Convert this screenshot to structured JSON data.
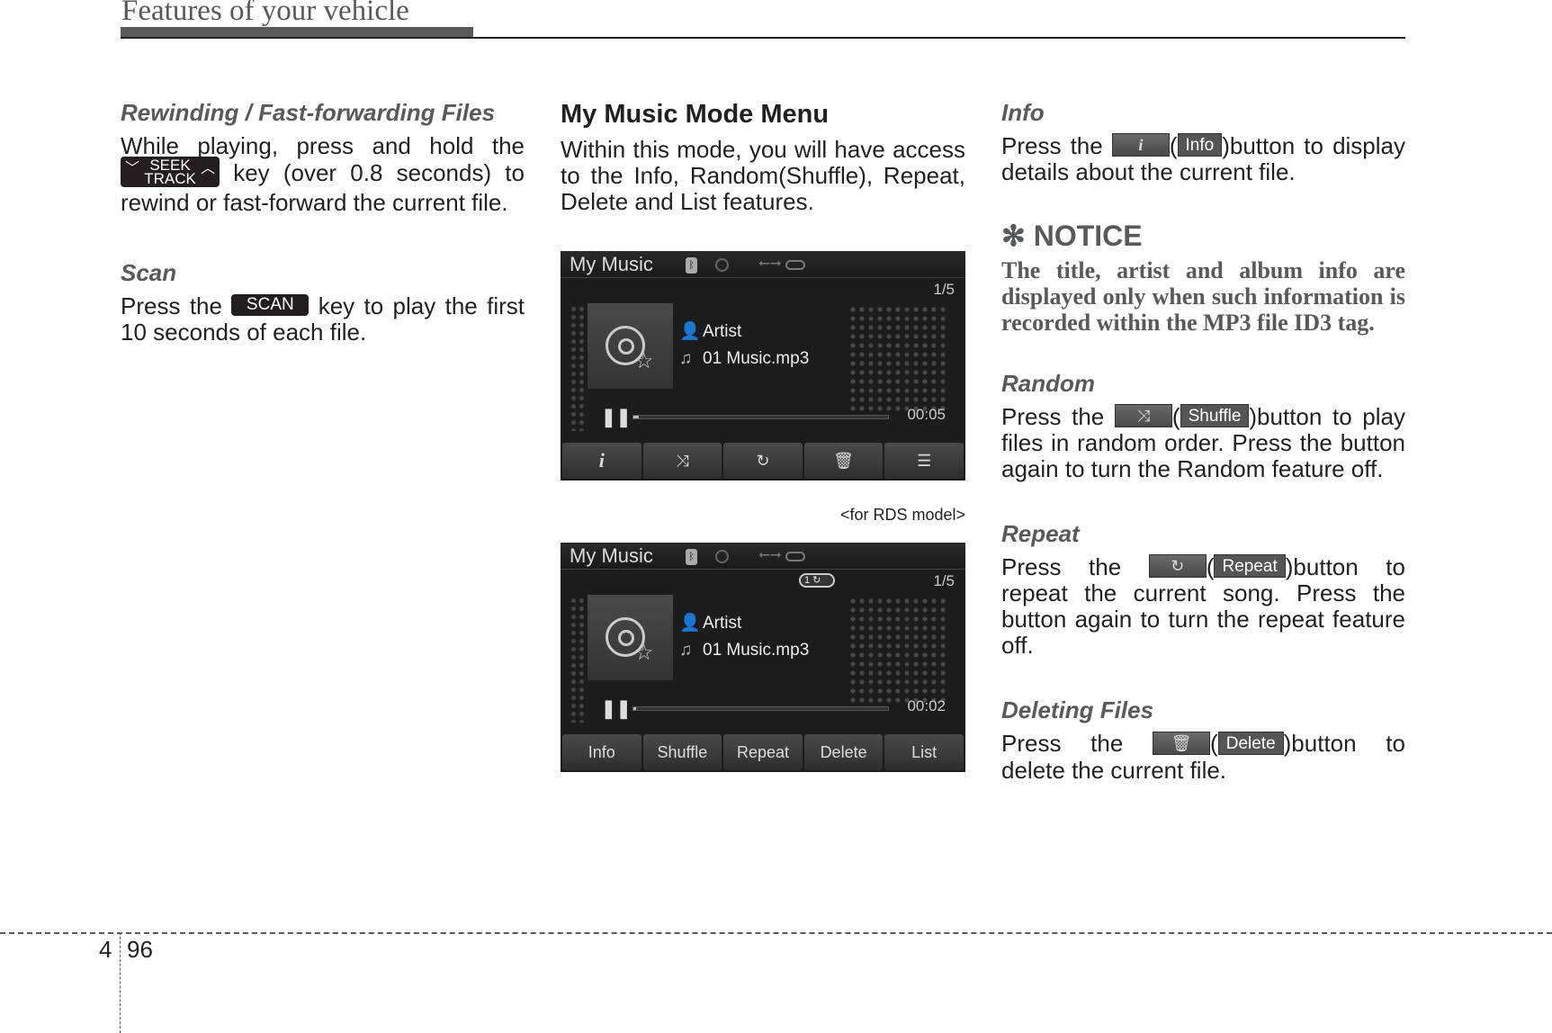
{
  "header": {
    "title": "Features of your vehicle"
  },
  "left": {
    "rewind": {
      "title": "Rewinding / Fast-forwarding Files",
      "text_before": "While playing, press and hold the",
      "key_top": "SEEK",
      "key_bottom": "TRACK",
      "text_after": "key (over 0.8 seconds) to rewind or fast-forward the current file."
    },
    "scan": {
      "title": "Scan",
      "text_before": "Press the",
      "key": "SCAN",
      "text_after": "key to play the first 10 seconds of each file."
    }
  },
  "middle": {
    "title": "My Music Mode Menu",
    "text": "Within this mode, you will have access to the Info, Random(Shuffle), Repeat, Delete and List features.",
    "caption": "<for RDS model>",
    "screens": [
      {
        "title": "My Music",
        "count": "1/5",
        "artist": "Artist",
        "file": "01 Music.mp3",
        "time": "00:05",
        "progress": 0.02,
        "buttons": [
          "i",
          "⤨",
          "↻",
          "🗑",
          "☰"
        ]
      },
      {
        "title": "My Music",
        "count": "1/5",
        "repeat_badge": "1",
        "artist": "Artist",
        "file": "01 Music.mp3",
        "time": "00:02",
        "progress": 0.01,
        "buttons": [
          "Info",
          "Shuffle",
          "Repeat",
          "Delete",
          "List"
        ]
      }
    ]
  },
  "right": {
    "info": {
      "title": "Info",
      "before": "Press the",
      "icon": "i",
      "label": "Info",
      "after": ")button to display details about the current file."
    },
    "notice": {
      "title": "✻ NOTICE",
      "text": "The title, artist and album info are displayed only when such information is recorded within the MP3 file ID3 tag."
    },
    "random": {
      "title": "Random",
      "before": "Press the",
      "icon": "⤨",
      "label": "Shuffle",
      "after": ")button to play files in random order. Press the button again to turn the Random feature off."
    },
    "repeat": {
      "title": "Repeat",
      "before": "Press the",
      "icon": "↻",
      "label": "Repeat",
      "after": ")button to repeat the current song. Press the button again to turn the repeat feature off."
    },
    "delete": {
      "title": "Deleting Files",
      "before": "Press the",
      "icon": "🗑",
      "label": "Delete",
      "after": ")button to delete the current file."
    }
  },
  "footer": {
    "chapter": "4",
    "page": "96"
  }
}
